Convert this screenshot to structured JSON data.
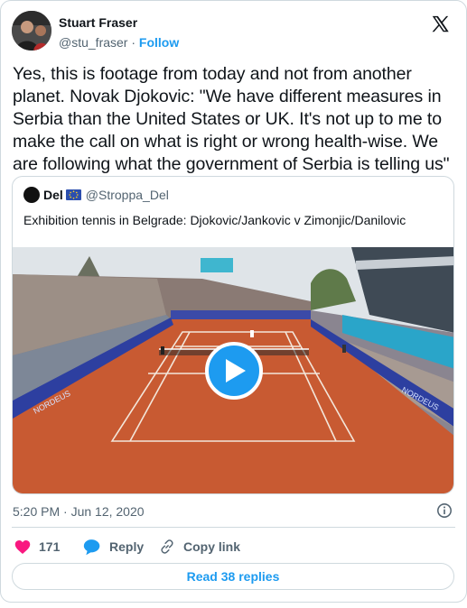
{
  "author": {
    "name": "Stuart Fraser",
    "handle": "@stu_fraser",
    "separator": "·",
    "follow_label": "Follow",
    "logo_icon": "x-logo-icon"
  },
  "tweet": {
    "text": "Yes, this is footage from today and not from another planet. Novak Djokovic: \"We have different measures in Serbia than the United States or UK. It's not up to me to make the call on what is right or wrong health-wise. We are following what the government of Serbia is telling us\"",
    "timestamp": "5:20 PM · Jun 12, 2020"
  },
  "quoted": {
    "name": "Del",
    "flag_icon": "eu-flag-icon",
    "handle": "@Stroppa_Del",
    "text": "Exhibition tennis in Belgrade: Djokovic/Jankovic v Zimonjic/Danilovic",
    "media": "video",
    "play_icon": "play-icon"
  },
  "actions": {
    "like_count": "171",
    "reply_label": "Reply",
    "copy_label": "Copy link"
  },
  "read_replies_label": "Read 38 replies",
  "colors": {
    "accent": "#1d9bf0",
    "like": "#f91880",
    "muted": "#536471",
    "border": "#cfd9de",
    "text": "#0f1419"
  }
}
